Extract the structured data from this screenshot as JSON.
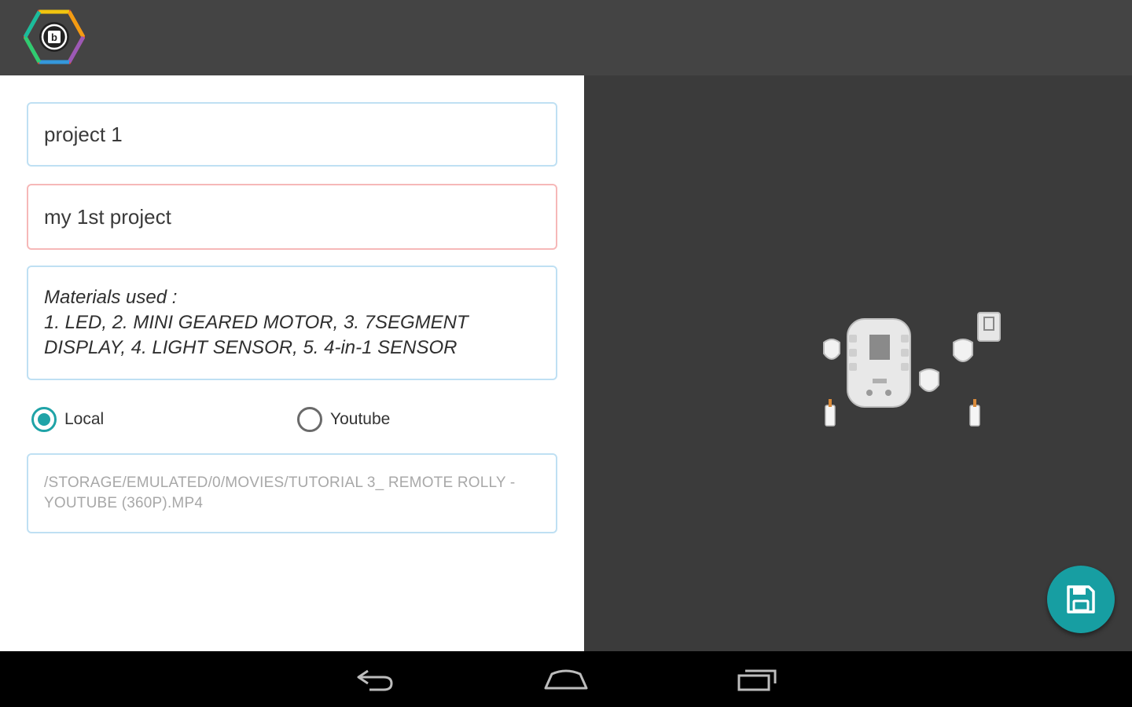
{
  "app": {
    "logo_icon": "chip-hexagon-logo-icon"
  },
  "form": {
    "name_value": "project 1",
    "description_value": "my 1st project",
    "materials_value": "Materials used :\n1. LED, 2. MINI GEARED MOTOR, 3. 7SEGMENT\nDISPLAY, 4. LIGHT SENSOR, 5. 4-in-1 SENSOR",
    "video_path_value": "/STORAGE/EMULATED/0/MOVIES/TUTORIAL 3_ REMOTE ROLLY - YOUTUBE (360P).MP4",
    "source_options": [
      {
        "label": "Local",
        "selected": true
      },
      {
        "label": "Youtube",
        "selected": false
      }
    ]
  },
  "preview": {
    "image_icon": "robot-components-illustration"
  },
  "fab": {
    "icon": "save-floppy-icon",
    "color": "#179ea2"
  },
  "navigation": {
    "back_icon": "back-icon",
    "home_icon": "home-icon",
    "recents_icon": "recents-icon"
  },
  "colors": {
    "accent": "#1fa3a7",
    "field_border": "#bfe0f3",
    "field_border_error": "#f6b8b8",
    "dark_panel": "#3b3b3b",
    "app_bar": "#444444"
  }
}
